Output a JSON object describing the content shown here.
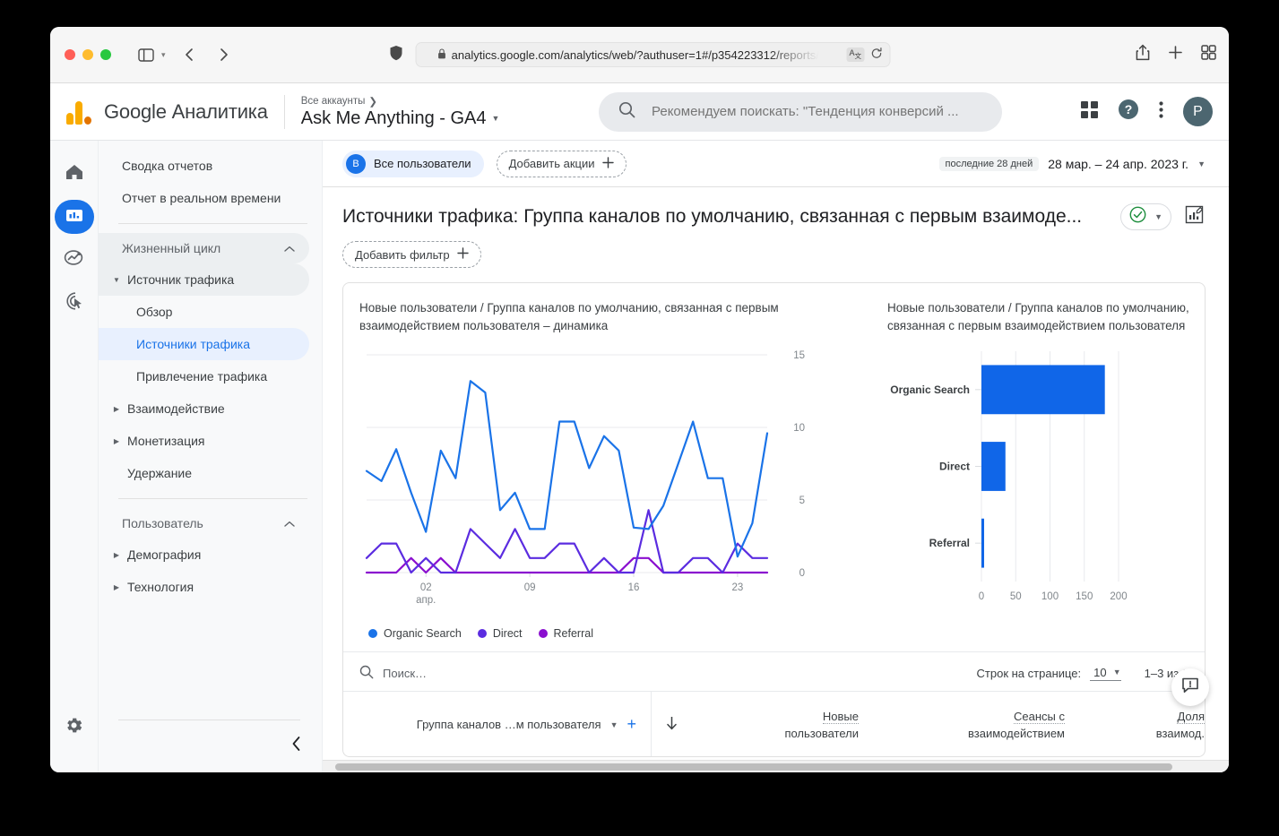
{
  "browser": {
    "url": "analytics.google.com/analytics/web/?authuser=1#/p354223312/reports/",
    "lock_icon": "lock-icon",
    "shield_icon": "shield-icon",
    "back_icon": "back-arrow-icon",
    "forward_icon": "forward-arrow-icon",
    "sidebar_icon": "sidebar-toggle-icon",
    "translate_icon": "translate-icon",
    "reload_icon": "reload-icon",
    "share_icon": "share-icon",
    "newtab_icon": "new-tab-icon",
    "tabs_overview_icon": "tab-overview-icon"
  },
  "header": {
    "brand": "Google Аналитика",
    "account_breadcrumb": "Все аккаунты",
    "property_name": "Ask Me Anything - GA4",
    "search_placeholder": "Рекомендуем поискать: \"Тенденция конверсий ...",
    "search_icon": "search-icon",
    "apps_icon": "apps-grid-icon",
    "help_icon": "help-icon",
    "more_icon": "more-vertical-icon",
    "avatar_letter": "P"
  },
  "rail": {
    "items": [
      {
        "name": "home-icon",
        "label": "Главная",
        "active": false
      },
      {
        "name": "reports-icon",
        "label": "Отчеты",
        "active": true
      },
      {
        "name": "explore-icon",
        "label": "Исследования",
        "active": false
      },
      {
        "name": "advertising-icon",
        "label": "Реклама",
        "active": false
      }
    ],
    "settings_icon": "gear-icon"
  },
  "sidebar": {
    "links": [
      {
        "label": "Сводка отчетов"
      },
      {
        "label": "Отчет в реальном времени"
      }
    ],
    "groups": [
      {
        "label": "Жизненный цикл",
        "collapse_icon": "chevron-up-icon",
        "items": [
          {
            "label": "Источник трафика",
            "expanded": true,
            "shaded": true,
            "children": [
              {
                "label": "Обзор",
                "selected": false
              },
              {
                "label": "Источники трафика",
                "selected": true
              },
              {
                "label": "Привлечение трафика",
                "selected": false
              }
            ]
          },
          {
            "label": "Взаимодействие",
            "expanded": false,
            "shaded": false,
            "children": []
          },
          {
            "label": "Монетизация",
            "expanded": false,
            "shaded": false,
            "children": []
          },
          {
            "label": "Удержание",
            "expanded": false,
            "shaded": false,
            "noarrow": true,
            "children": []
          }
        ]
      },
      {
        "label": "Пользователь",
        "collapse_icon": "chevron-up-icon",
        "items": [
          {
            "label": "Демография",
            "expanded": false,
            "shaded": false,
            "children": []
          },
          {
            "label": "Технология",
            "expanded": false,
            "shaded": false,
            "children": []
          }
        ]
      }
    ],
    "collapse_icon": "chevron-left-icon"
  },
  "toolbar": {
    "segment_badge": "В",
    "segment_label": "Все пользователи",
    "add_comparison_label": "Добавить акции",
    "add_icon": "plus-icon",
    "date_pill": "последние 28 дней",
    "date_range": "28 мар. – 24 апр. 2023 г.",
    "date_caret_icon": "chevron-down-icon"
  },
  "report": {
    "title": "Источники трафика: Группа каналов по умолчанию, связанная с первым взаимоде...",
    "status_icon": "check-circle-icon",
    "status_caret_icon": "chevron-down-icon",
    "edit_icon": "edit-chart-icon",
    "add_filter_label": "Добавить фильтр"
  },
  "table": {
    "search_placeholder": "Поиск…",
    "search_icon": "search-icon",
    "rows_per_page_label": "Строк на странице:",
    "rows_per_page_value": "10",
    "rows_caret_icon": "chevron-down-icon",
    "range_label": "1–3 из 3",
    "dimension_header": "Группа каналов …м пользователя",
    "dimension_caret_icon": "chevron-down-icon",
    "dimension_add_icon": "plus-icon",
    "sort_icon": "sort-descending-icon",
    "metric_headers": [
      "Новые\nпользователи",
      "Сеансы с\nвзаимодействием",
      "Доля\nвзаимод."
    ]
  },
  "feedback": {
    "icon": "feedback-icon"
  },
  "colors": {
    "accent_blue": "#1a73e8",
    "organic_search": "#1a73e8",
    "direct": "#5b2ce0",
    "referral": "#8a0fcf",
    "bar_blue": "#1066e8",
    "green_check": "#1e8e3e"
  },
  "chart_data": [
    {
      "type": "line",
      "title": "Новые пользователи / Группа каналов по умолчанию, связанная с первым взаимодействием пользователя – динамика",
      "xlabel": "",
      "ylabel": "",
      "ylim": [
        0,
        15
      ],
      "yticks": [
        0,
        5,
        10,
        15
      ],
      "xticks": [
        "02\nапр.",
        "09",
        "16",
        "23"
      ],
      "xtick_positions": [
        4,
        11,
        18,
        25
      ],
      "x": [
        1,
        2,
        3,
        4,
        5,
        6,
        7,
        8,
        9,
        10,
        11,
        12,
        13,
        14,
        15,
        16,
        17,
        18,
        19,
        20,
        21,
        22,
        23,
        24,
        25,
        26,
        27,
        28
      ],
      "legend_position": "bottom",
      "grid": true,
      "series": [
        {
          "name": "Organic Search",
          "color": "#1a73e8",
          "values": [
            7,
            6.3,
            8.5,
            5.5,
            2.8,
            8.4,
            6.5,
            13.2,
            12.4,
            4.3,
            5.5,
            3,
            3,
            10.4,
            10.4,
            7.2,
            9.4,
            8.4,
            3.1,
            3,
            4.6,
            7.5,
            10.4,
            6.5,
            6.5,
            1.1,
            3.4,
            9.6
          ]
        },
        {
          "name": "Direct",
          "color": "#5b2ce0",
          "values": [
            1,
            2,
            2,
            0,
            1,
            0,
            0,
            3,
            2,
            1,
            3,
            1,
            1,
            2,
            2,
            0,
            1,
            0,
            0,
            4.3,
            0,
            0,
            1,
            1,
            0,
            2,
            1,
            1
          ]
        },
        {
          "name": "Referral",
          "color": "#8a0fcf",
          "values": [
            0,
            0,
            0,
            1,
            0,
            1,
            0,
            0,
            0,
            0,
            0,
            0,
            0,
            0,
            0,
            0,
            0,
            0,
            1,
            1,
            0,
            0,
            0,
            0,
            0,
            0,
            0,
            0
          ]
        }
      ]
    },
    {
      "type": "bar",
      "orientation": "horizontal",
      "title": "Новые пользователи / Группа каналов по умолчанию, связанная с первым взаимодействием пользователя",
      "categories": [
        "Organic Search",
        "Direct",
        "Referral"
      ],
      "values": [
        180,
        35,
        2
      ],
      "xlim": [
        0,
        200
      ],
      "xticks": [
        0,
        50,
        100,
        150,
        200
      ],
      "color": "#1066e8",
      "grid": true
    }
  ]
}
